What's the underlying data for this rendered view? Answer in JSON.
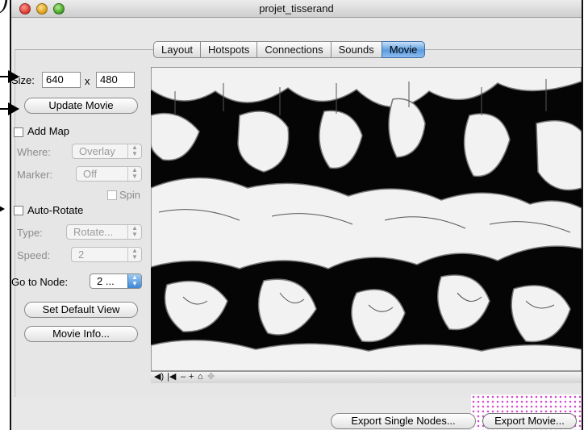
{
  "window": {
    "title": "projet_tisserand"
  },
  "tabs": [
    {
      "label": "Layout",
      "selected": false
    },
    {
      "label": "Hotspots",
      "selected": false
    },
    {
      "label": "Connections",
      "selected": false
    },
    {
      "label": "Sounds",
      "selected": false
    },
    {
      "label": "Movie",
      "selected": true
    }
  ],
  "size": {
    "label": "Size:",
    "width": "640",
    "separator": "x",
    "height": "480"
  },
  "buttons": {
    "update_movie": "Update Movie",
    "set_default_view": "Set Default View",
    "movie_info": "Movie Info...",
    "export_single_nodes": "Export Single Nodes...",
    "export_movie": "Export Movie..."
  },
  "add_map": {
    "label": "Add Map",
    "checked": false,
    "where_label": "Where:",
    "where_value": "Overlay",
    "marker_label": "Marker:",
    "marker_value": "Off",
    "spin_label": "Spin"
  },
  "auto_rotate": {
    "label": "Auto-Rotate",
    "checked": false,
    "type_label": "Type:",
    "type_value": "Rotate...",
    "speed_label": "Speed:",
    "speed_value": "2"
  },
  "go_to_node": {
    "label": "Go to Node:",
    "value": "2 ..."
  },
  "controller": {
    "glyphs": "◀) |◀ – + ⌂ ✥"
  },
  "colors": {
    "accent": "#5c9be0",
    "annotation_dots": "#d64bd0"
  }
}
